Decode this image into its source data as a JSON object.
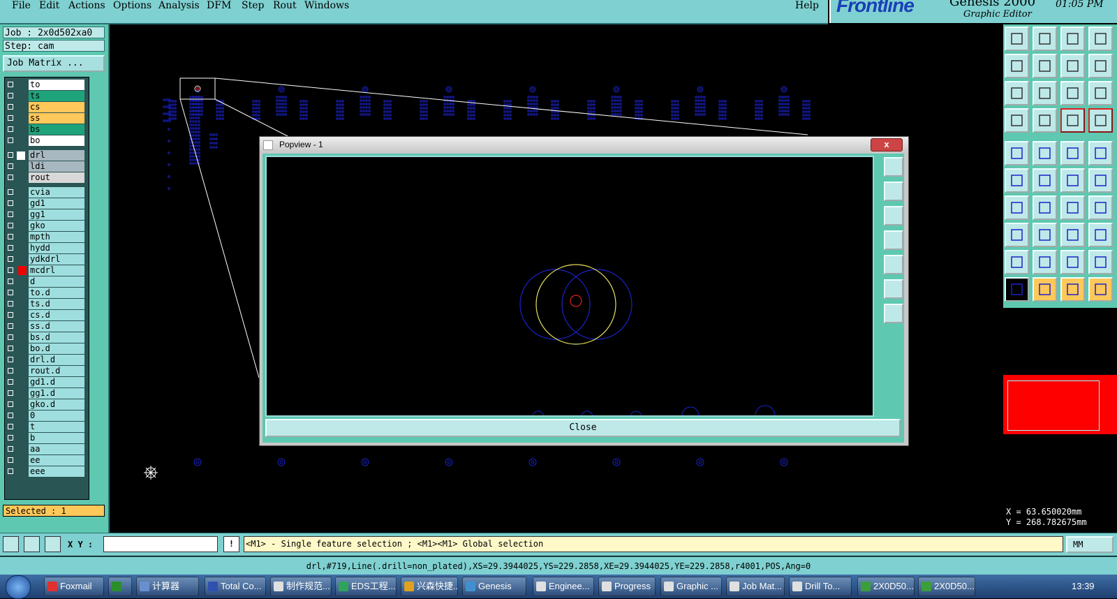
{
  "menu": {
    "items": [
      "File",
      "Edit",
      "Actions",
      "Options",
      "Analysis",
      "DFM",
      "Step",
      "Rout",
      "Windows"
    ],
    "help": "Help"
  },
  "brand": {
    "logo": "Frontline",
    "product": "Genesis 2000",
    "subtitle": "Graphic Editor",
    "clock": "01:05 PM"
  },
  "left_panel": {
    "job": "Job : 2x0d502xa0",
    "step": "Step: cam",
    "job_matrix": "Job Matrix ...",
    "selected": "Selected : 1"
  },
  "layers": [
    {
      "name": "to",
      "color": "#ffffff"
    },
    {
      "name": "ts",
      "color": "#1fa37a"
    },
    {
      "name": "cs",
      "color": "#ffc85a"
    },
    {
      "name": "ss",
      "color": "#ffc85a"
    },
    {
      "name": "bs",
      "color": "#1fa37a"
    },
    {
      "name": "bo",
      "color": "#ffffff"
    },
    {
      "name": "drl",
      "color": "#a8b8c0"
    },
    {
      "name": "ldi",
      "color": "#a8b8c0"
    },
    {
      "name": "rout",
      "color": "#d8d8d8"
    },
    {
      "name": "cvia",
      "color": "#9fdede"
    },
    {
      "name": "gd1",
      "color": "#9fdede"
    },
    {
      "name": "gg1",
      "color": "#9fdede"
    },
    {
      "name": "gko",
      "color": "#9fdede"
    },
    {
      "name": "mpth",
      "color": "#9fdede"
    },
    {
      "name": "hydd",
      "color": "#9fdede"
    },
    {
      "name": "ydkdrl",
      "color": "#9fdede"
    },
    {
      "name": "mcdrl",
      "color": "#9fdede"
    },
    {
      "name": "d",
      "color": "#9fdede"
    },
    {
      "name": "to.d",
      "color": "#9fdede"
    },
    {
      "name": "ts.d",
      "color": "#9fdede"
    },
    {
      "name": "cs.d",
      "color": "#9fdede"
    },
    {
      "name": "ss.d",
      "color": "#9fdede"
    },
    {
      "name": "bs.d",
      "color": "#9fdede"
    },
    {
      "name": "bo.d",
      "color": "#9fdede"
    },
    {
      "name": "drl.d",
      "color": "#9fdede"
    },
    {
      "name": "rout.d",
      "color": "#9fdede"
    },
    {
      "name": "gd1.d",
      "color": "#9fdede"
    },
    {
      "name": "gg1.d",
      "color": "#9fdede"
    },
    {
      "name": "gko.d",
      "color": "#9fdede"
    },
    {
      "name": "0",
      "color": "#9fdede"
    },
    {
      "name": "t",
      "color": "#9fdede"
    },
    {
      "name": "b",
      "color": "#9fdede"
    },
    {
      "name": "aa",
      "color": "#9fdede"
    },
    {
      "name": "ee",
      "color": "#9fdede"
    },
    {
      "name": "eee",
      "color": "#9fdede"
    }
  ],
  "popview": {
    "title": "Popview - 1",
    "close_x": "x",
    "close_label": "Close"
  },
  "coords": {
    "x": "X = 63.650020mm",
    "y": "Y = 268.782675mm"
  },
  "cmdbar": {
    "xy_label": "X Y :",
    "xy_value": "",
    "alert": "!",
    "hint": "<M1> - Single feature selection ; <M1><M1> Global selection",
    "units": "MM"
  },
  "status_line": "drl,#719,Line(.drill=non_plated),XS=29.3944025,YS=229.2858,XE=29.3944025,YE=229.2858,r4001,POS,Ang=0",
  "taskbar": {
    "items": [
      "Foxmail",
      "",
      "计算器",
      "Total Co...",
      "制作规范...",
      "EDS工程...",
      "兴森快捷...",
      "Genesis",
      "Enginee...",
      "Progress",
      "Graphic ...",
      "Job Mat...",
      "Drill To...",
      "2X0D50...",
      "2X0D50..."
    ],
    "time": "13:39"
  },
  "colors": {
    "panel": "#5ec8b0",
    "menubar": "#7fd0d0",
    "drill_blue": "#1a22c8",
    "highlight_yellow": "#e8e060",
    "pad_red": "#e02020"
  }
}
